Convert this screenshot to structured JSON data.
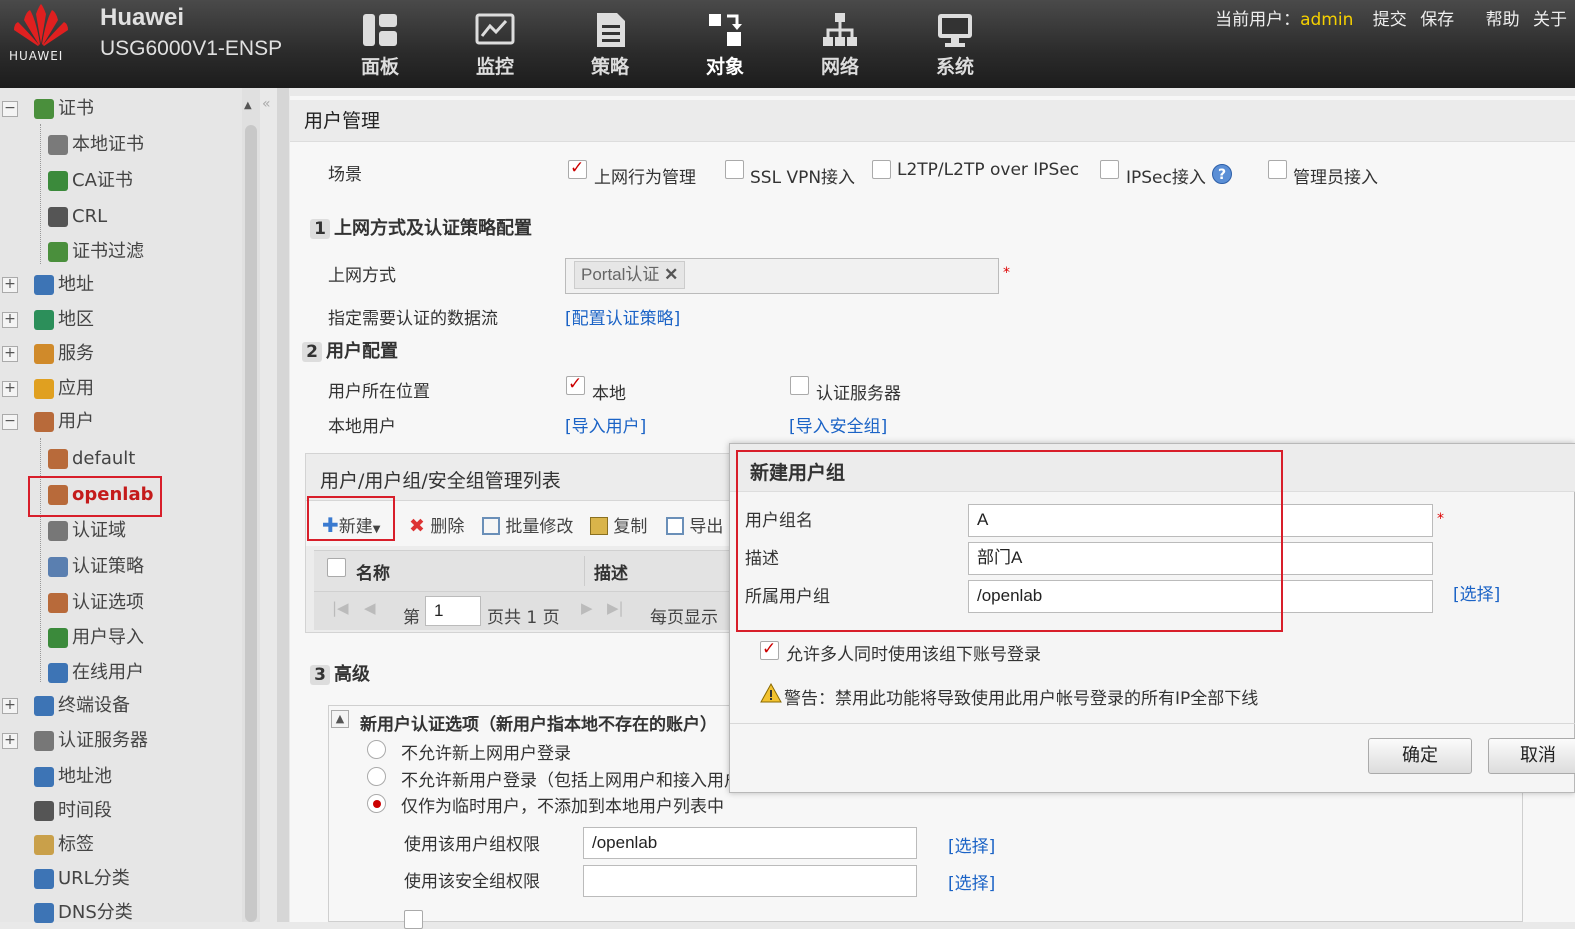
{
  "header": {
    "logo_text": "HUAWEI",
    "brand": "Huawei",
    "model": "USG6000V1-ENSP",
    "nav": [
      "面板",
      "监控",
      "策略",
      "对象",
      "网络",
      "系统"
    ],
    "current_user_label": "当前用户：",
    "current_user": "admin",
    "actions": [
      "提交",
      "保存",
      "帮助",
      "关于"
    ]
  },
  "sidebar": {
    "items": [
      {
        "label": "证书",
        "expander": "−",
        "icon": "certificate-icon",
        "color": "#4a8f3c"
      },
      {
        "label": "本地证书",
        "icon": "local-cert-icon",
        "color": "#7a7a7a"
      },
      {
        "label": "CA证书",
        "icon": "ca-cert-icon",
        "color": "#3b8a3b"
      },
      {
        "label": "CRL",
        "icon": "crl-icon",
        "color": "#555555"
      },
      {
        "label": "证书过滤",
        "icon": "cert-filter-icon",
        "color": "#4a8f3c"
      },
      {
        "label": "地址",
        "expander": "+",
        "icon": "monitor-icon",
        "color": "#3d74b5"
      },
      {
        "label": "地区",
        "expander": "+",
        "icon": "globe-icon",
        "color": "#2c8f5a"
      },
      {
        "label": "服务",
        "expander": "+",
        "icon": "service-icon",
        "color": "#d08a2a"
      },
      {
        "label": "应用",
        "expander": "+",
        "icon": "app-icon",
        "color": "#e0a020"
      },
      {
        "label": "用户",
        "expander": "−",
        "icon": "user-icon",
        "color": "#b86a3a"
      },
      {
        "label": "default",
        "icon": "user-group-icon",
        "color": "#b86a3a"
      },
      {
        "label": "openlab",
        "icon": "user-group-icon",
        "color": "#b86a3a"
      },
      {
        "label": "认证域",
        "icon": "auth-domain-icon",
        "color": "#777777"
      },
      {
        "label": "认证策略",
        "icon": "auth-policy-icon",
        "color": "#5a7fb0"
      },
      {
        "label": "认证选项",
        "icon": "auth-option-icon",
        "color": "#b86a3a"
      },
      {
        "label": "用户导入",
        "icon": "user-import-icon",
        "color": "#3b8a3b"
      },
      {
        "label": "在线用户",
        "icon": "online-user-icon",
        "color": "#3d74b5"
      },
      {
        "label": "终端设备",
        "expander": "+",
        "icon": "terminal-icon",
        "color": "#3d74b5"
      },
      {
        "label": "认证服务器",
        "expander": "+",
        "icon": "auth-server-icon",
        "color": "#777777"
      },
      {
        "label": "地址池",
        "icon": "address-pool-icon",
        "color": "#3d74b5"
      },
      {
        "label": "时间段",
        "icon": "calendar-icon",
        "color": "#555555"
      },
      {
        "label": "标签",
        "icon": "tag-icon",
        "color": "#c9a04a"
      },
      {
        "label": "URL分类",
        "icon": "url-icon",
        "color": "#3d74b5"
      },
      {
        "label": "DNS分类",
        "icon": "dns-icon",
        "color": "#3d74b5"
      }
    ]
  },
  "main": {
    "title": "用户管理",
    "scene_label": "场景",
    "scenes": [
      {
        "label": "上网行为管理",
        "checked": true
      },
      {
        "label": "SSL VPN接入",
        "checked": false
      },
      {
        "label": "L2TP/L2TP over IPSec",
        "checked": false
      },
      {
        "label": "IPSec接入",
        "checked": false
      },
      {
        "label": "管理员接入",
        "checked": false
      }
    ],
    "section1": {
      "num": "1",
      "title": "上网方式及认证策略配置"
    },
    "access_mode_label": "上网方式",
    "access_mode_tag": "Portal认证",
    "dataflow_label": "指定需要认证的数据流",
    "dataflow_link": "[配置认证策略]",
    "section2": {
      "num": "2",
      "title": "用户配置"
    },
    "user_location_label": "用户所在位置",
    "loc_local": "本地",
    "loc_server": "认证服务器",
    "local_user_label": "本地用户",
    "import_user": "[导入用户]",
    "import_secgroup": "[导入安全组]",
    "list_title": "用户/用户组/安全组管理列表",
    "toolbar": {
      "new": "新建",
      "delete": "删除",
      "batch": "批量修改",
      "copy": "复制",
      "export": "导出"
    },
    "col_name": "名称",
    "col_desc": "描述",
    "pager": {
      "page_prefix": "第",
      "page": "1",
      "page_suffix": "页共 1 页",
      "per_page": "每页显示"
    },
    "section3": {
      "num": "3",
      "title": "高级"
    },
    "newuser_title": "新用户认证选项（新用户指本地不存在的账户）",
    "options": [
      {
        "label": "不允许新上网用户登录",
        "selected": false
      },
      {
        "label": "不允许新用户登录（包括上网用户和接入用户）",
        "selected": false
      },
      {
        "label": "仅作为临时用户，不添加到本地用户列表中",
        "selected": true
      }
    ],
    "use_group_label": "使用该用户组权限",
    "use_group_value": "/openlab",
    "use_secgroup_label": "使用该安全组权限",
    "use_secgroup_value": "",
    "select_link": "[选择]"
  },
  "dialog": {
    "title": "新建用户组",
    "name_label": "用户组名",
    "name_value": "A",
    "desc_label": "描述",
    "desc_value": "部门A",
    "parent_label": "所属用户组",
    "parent_value": "/openlab",
    "select_link": "[选择]",
    "allow_multi": "允许多人同时使用该组下账号登录",
    "warning": "警告：禁用此功能将导致使用此用户帐号登录的所有IP全部下线",
    "ok": "确定",
    "cancel": "取消"
  }
}
